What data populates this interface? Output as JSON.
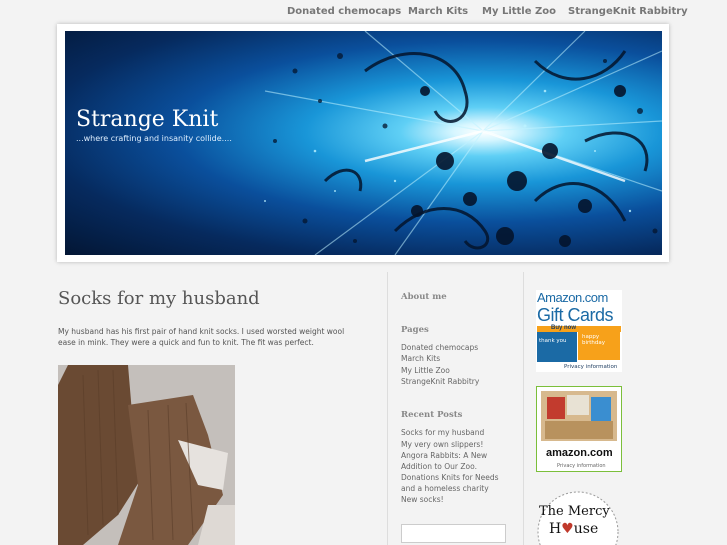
{
  "nav": {
    "items": [
      "Donated chemocaps",
      "March Kits",
      "My Little Zoo",
      "StrangeKnit Rabbitry"
    ]
  },
  "header": {
    "title": "Strange Knit",
    "tagline": "...where crafting and insanity collide...."
  },
  "post": {
    "title": "Socks for my husband",
    "body": "My husband has his first pair of hand knit socks. I used worsted weight wool ease in mink. They were a quick and fun to knit. The fit was perfect."
  },
  "sidebar": {
    "about_heading": "About me",
    "pages_heading": "Pages",
    "pages": [
      "Donated chemocaps",
      "March Kits",
      "My Little Zoo",
      "StrangeKnit Rabbitry"
    ],
    "recent_heading": "Recent Posts",
    "recent": [
      "Socks for my husband",
      "My very own slippers!",
      "Angora Rabbits: A New Addition to Our Zoo.",
      "Donations Knits for Needs and a homeless charity",
      "New socks!"
    ]
  },
  "ads": {
    "giftcards": {
      "brand": "Amazon.com",
      "product": "Gift Cards",
      "buy": "Buy now",
      "thankyou": "thank you",
      "birthday": "happy birthday",
      "privacy": "Privacy information"
    },
    "amazon_box": {
      "brand": "amazon.com",
      "privacy": "Privacy information"
    },
    "mercy": {
      "line1": "The Mercy",
      "line2": "H",
      "line3": "use"
    }
  },
  "colors": {
    "accent": "#1996d8",
    "amazon_orange": "#f7a11a",
    "amazon_blue": "#1b6aa5"
  }
}
